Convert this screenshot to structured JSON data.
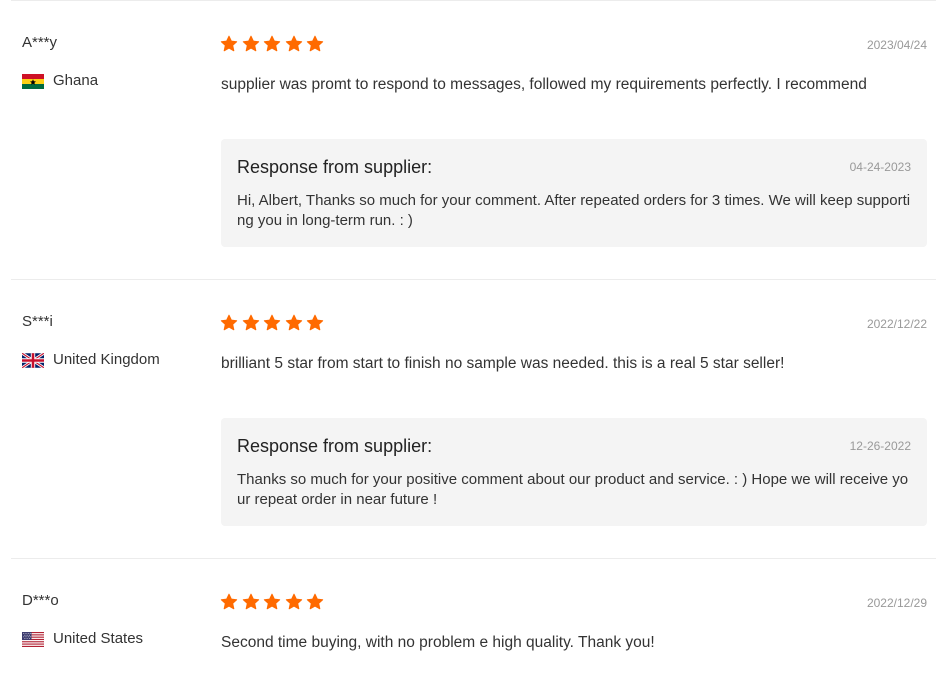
{
  "colors": {
    "star": "#ff6a00",
    "response_background": "#f4f4f4",
    "divider": "#ececec"
  },
  "reviews": [
    {
      "buyer": "A***y",
      "country": "Ghana",
      "flag_icon": "ghana-flag-icon",
      "rating": 5,
      "date": "2023/04/24",
      "text": "supplier was promt to respond to messages, followed my requirements perfectly. I recommend",
      "response": {
        "title": "Response from supplier:",
        "date": "04-24-2023",
        "text": "Hi, Albert, Thanks so much for your comment. After repeated orders for 3 times. We will keep supporting you in long-term run. : )"
      }
    },
    {
      "buyer": "S***i",
      "country": "United Kingdom",
      "flag_icon": "united-kingdom-flag-icon",
      "rating": 5,
      "date": "2022/12/22",
      "text": "brilliant 5 star from start to finish no sample was needed. this is a real 5 star seller!",
      "response": {
        "title": "Response from supplier:",
        "date": "12-26-2022",
        "text": "Thanks so much for your positive comment about our product and service. : ) Hope we will receive your repeat order in near future !"
      }
    },
    {
      "buyer": "D***o",
      "country": "United States",
      "flag_icon": "united-states-flag-icon",
      "rating": 5,
      "date": "2022/12/29",
      "text": "Second time buying, with no problem e high quality. Thank you!"
    }
  ]
}
